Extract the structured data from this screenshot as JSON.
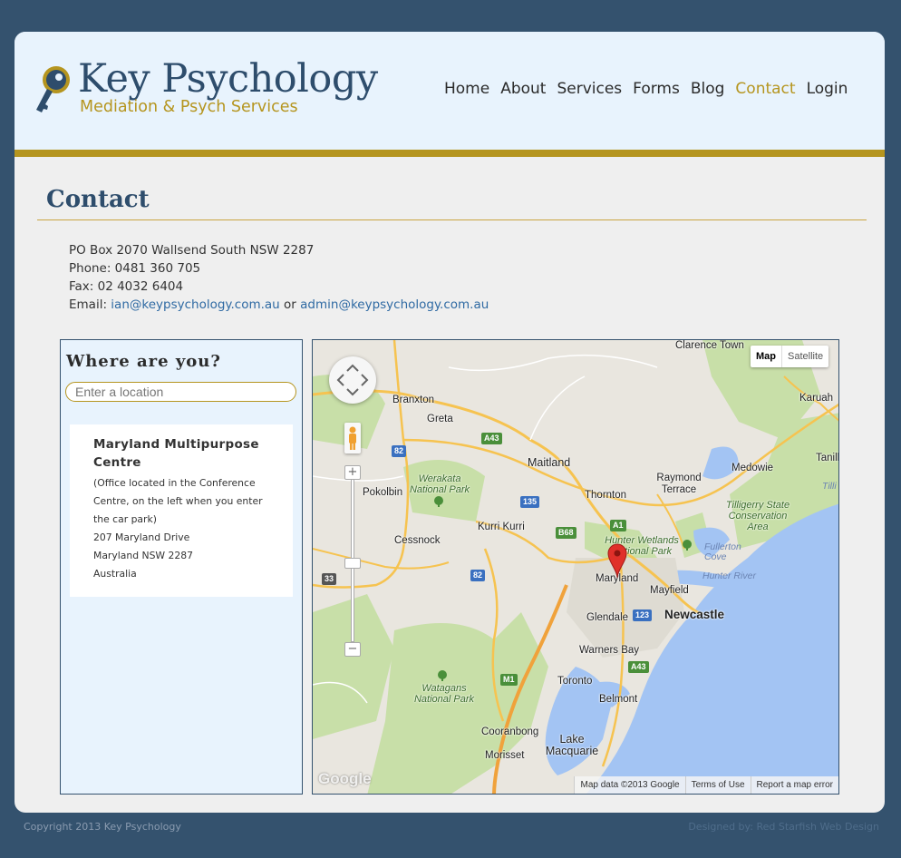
{
  "site": {
    "title": "Key Psychology",
    "subtitle": "Mediation & Psych Services"
  },
  "nav": {
    "items": [
      {
        "label": "Home",
        "active": false
      },
      {
        "label": "About",
        "active": false
      },
      {
        "label": "Services",
        "active": false
      },
      {
        "label": "Forms",
        "active": false
      },
      {
        "label": "Blog",
        "active": false
      },
      {
        "label": "Contact",
        "active": true
      },
      {
        "label": "Login",
        "active": false
      }
    ]
  },
  "page": {
    "title": "Contact"
  },
  "contact": {
    "address": "PO Box 2070 Wallsend South NSW 2287",
    "phone": "Phone: 0481 360 705",
    "fax": "Fax: 02 4032 6404",
    "email_prefix": "Email: ",
    "email_1": "ian@keypsychology.com.au",
    "email_sep": " or ",
    "email_2": "admin@keypsychology.com.au"
  },
  "locator": {
    "title": "Where are you?",
    "input_placeholder": "Enter a location",
    "location_name": "Maryland Multipurpose Centre",
    "location_note": "(Office located in the Conference Centre, on the left when you enter the car park)",
    "address_line1": "207 Maryland Drive",
    "address_line2": "Maryland NSW 2287",
    "country": "Australia"
  },
  "map": {
    "type_map": "Map",
    "type_satellite": "Satellite",
    "zoom_in": "+",
    "zoom_out": "−",
    "logo": "Google",
    "footer_data": "Map data ©2013 Google",
    "footer_terms": "Terms of Use",
    "footer_report": "Report a map error",
    "labels": {
      "clarence_town": "Clarence Town",
      "branxton": "Branxton",
      "greta": "Greta",
      "karuah": "Karuah",
      "maitland": "Maitland",
      "raymond_terrace": "Raymond Terrace",
      "medowie": "Medowie",
      "tanilba": "Tanill",
      "pokolbin": "Pokolbin",
      "werakata": "Werakata National Park",
      "thornton": "Thornton",
      "tilligerry": "Tilligerry State Conservation Area",
      "kurri_kurri": "Kurri Kurri",
      "cessnock": "Cessnock",
      "hunter_wetlands": "Hunter Wetlands National Park",
      "fullerton_cove": "Fullerton Cove",
      "hunter_river": "Hunter River",
      "maryland": "Maryland",
      "mayfield": "Mayfield",
      "glendale": "Glendale",
      "newcastle": "Newcastle",
      "warners_bay": "Warners Bay",
      "toronto": "Toronto",
      "watagans": "Watagans National Park",
      "belmont": "Belmont",
      "cooranbong": "Cooranbong",
      "lake_macquarie": "Lake Macquarie",
      "morisset": "Morisset",
      "tilli": "Tilli"
    },
    "shields": {
      "a43_top": "A43",
      "r82_top": "82",
      "r135": "135",
      "b68": "B68",
      "a1": "A1",
      "r82_mid": "82",
      "r33": "33",
      "r123": "123",
      "a43_bottom": "A43",
      "m1": "M1"
    },
    "colors": {
      "land": "#e9e6df",
      "park": "#c8dfa8",
      "water": "#a3c4f3",
      "road_major": "#f6c350",
      "motorway": "#f0a23b",
      "marker": "#e0302a"
    }
  },
  "footer": {
    "copyright": "Copyright 2013 Key Psychology",
    "designed_by": "Designed by: Red Starfish Web Design"
  },
  "colors": {
    "page_bg": "#34526e",
    "header_bg": "#e8f3fd",
    "accent_gold": "#b5951f",
    "navy": "#2e4d6c",
    "link": "#2f6aa3"
  }
}
